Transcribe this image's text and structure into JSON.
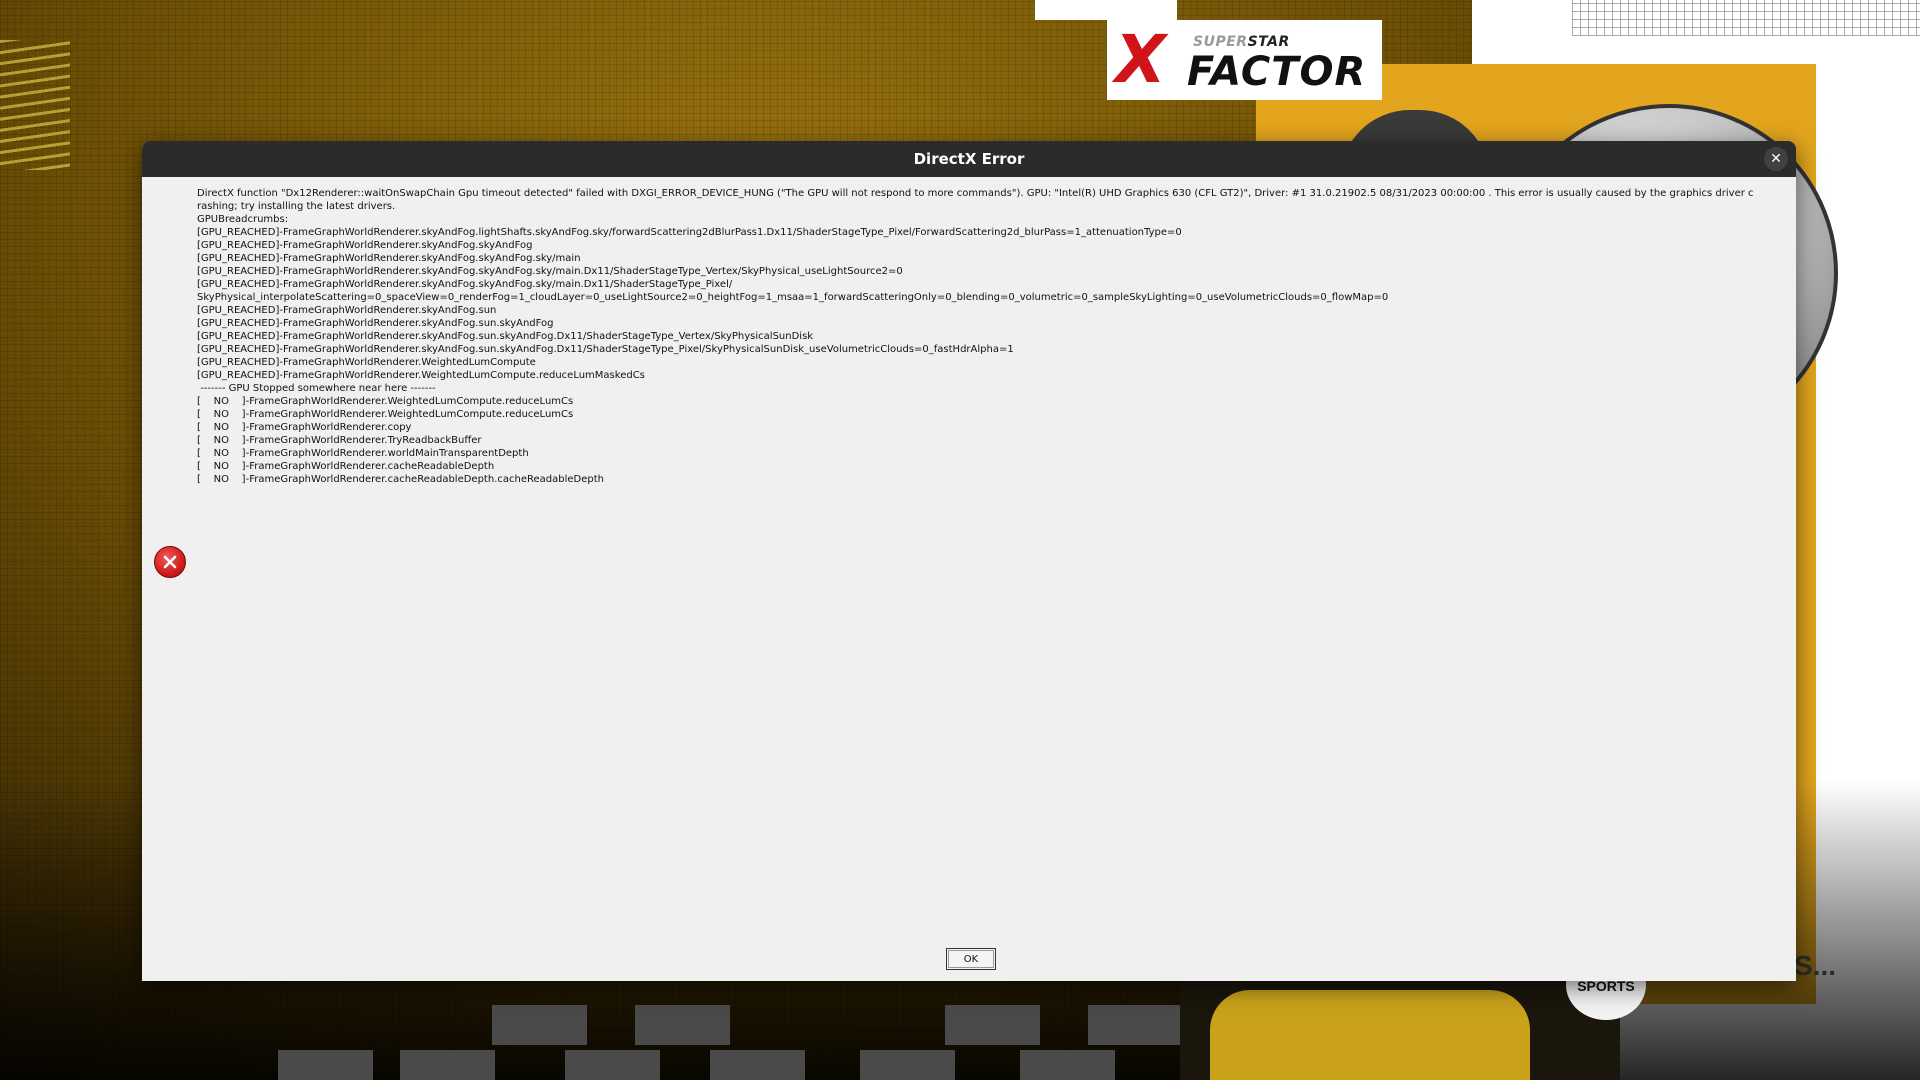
{
  "background": {
    "logo": {
      "x": "X",
      "super": "SUPER",
      "star": "STAR",
      "factor": "FACTOR"
    },
    "sports_badge": "SPORTS",
    "ellipsis_text": "S..."
  },
  "dialog": {
    "title": "DirectX Error",
    "close_glyph": "✕",
    "message": "DirectX function \"Dx12Renderer::waitOnSwapChain Gpu timeout detected\" failed with DXGI_ERROR_DEVICE_HUNG (\"The GPU will not respond to more commands\"). GPU: \"Intel(R) UHD Graphics 630 (CFL GT2)\", Driver: #1 31.0.21902.5 08/31/2023 00:00:00 . This error is usually caused by the graphics driver crashing; try installing the latest drivers.\nGPUBreadcrumbs:\n[GPU_REACHED]-FrameGraphWorldRenderer.skyAndFog.lightShafts.skyAndFog.sky/forwardScattering2dBlurPass1.Dx11/ShaderStageType_Pixel/ForwardScattering2d_blurPass=1_attenuationType=0\n[GPU_REACHED]-FrameGraphWorldRenderer.skyAndFog.skyAndFog\n[GPU_REACHED]-FrameGraphWorldRenderer.skyAndFog.skyAndFog.sky/main\n[GPU_REACHED]-FrameGraphWorldRenderer.skyAndFog.skyAndFog.sky/main.Dx11/ShaderStageType_Vertex/SkyPhysical_useLightSource2=0\n[GPU_REACHED]-FrameGraphWorldRenderer.skyAndFog.skyAndFog.sky/main.Dx11/ShaderStageType_Pixel/\nSkyPhysical_interpolateScattering=0_spaceView=0_renderFog=1_cloudLayer=0_useLightSource2=0_heightFog=1_msaa=1_forwardScatteringOnly=0_blending=0_volumetric=0_sampleSkyLighting=0_useVolumetricClouds=0_flowMap=0\n[GPU_REACHED]-FrameGraphWorldRenderer.skyAndFog.sun\n[GPU_REACHED]-FrameGraphWorldRenderer.skyAndFog.sun.skyAndFog\n[GPU_REACHED]-FrameGraphWorldRenderer.skyAndFog.sun.skyAndFog.Dx11/ShaderStageType_Vertex/SkyPhysicalSunDisk\n[GPU_REACHED]-FrameGraphWorldRenderer.skyAndFog.sun.skyAndFog.Dx11/ShaderStageType_Pixel/SkyPhysicalSunDisk_useVolumetricClouds=0_fastHdrAlpha=1\n[GPU_REACHED]-FrameGraphWorldRenderer.WeightedLumCompute\n[GPU_REACHED]-FrameGraphWorldRenderer.WeightedLumCompute.reduceLumMaskedCs\n ------- GPU Stopped somewhere near here -------\n[    NO    ]-FrameGraphWorldRenderer.WeightedLumCompute.reduceLumCs\n[    NO    ]-FrameGraphWorldRenderer.WeightedLumCompute.reduceLumCs\n[    NO    ]-FrameGraphWorldRenderer.copy\n[    NO    ]-FrameGraphWorldRenderer.TryReadbackBuffer\n[    NO    ]-FrameGraphWorldRenderer.worldMainTransparentDepth\n[    NO    ]-FrameGraphWorldRenderer.cacheReadableDepth\n[    NO    ]-FrameGraphWorldRenderer.cacheReadableDepth.cacheReadableDepth",
    "ok_label": "OK",
    "icon": "error-x-icon"
  },
  "colors": {
    "titlebar": "#2b2b2b",
    "dialog_bg": "#f0f0f0",
    "error_red": "#d21c1c",
    "gold": "#e2a51d",
    "logo_red": "#d0141a"
  }
}
